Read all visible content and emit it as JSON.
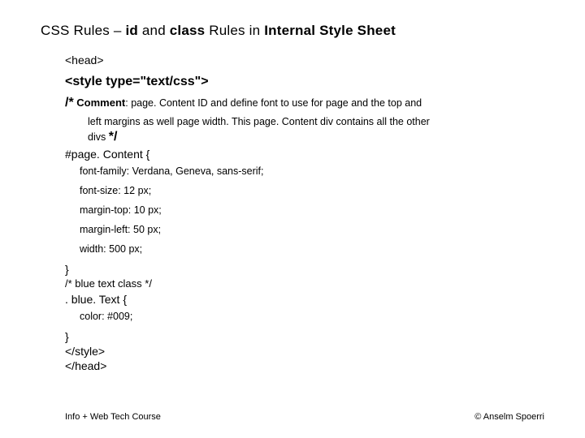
{
  "title": {
    "prefix": "CSS Rules – ",
    "bold1": "id",
    "mid1": " and ",
    "bold2": "class",
    "mid2": " Rules in ",
    "bold3": "Internal Style Sheet"
  },
  "code": {
    "head_open": "<head>",
    "style_open": "<style type=\"text/css\">",
    "comment1": {
      "open": "/*",
      "label": "Comment",
      "body1": ": page. Content ID and define font to use for page and the top and",
      "body2": "left margins as well page width. This page. Content div contains all the other",
      "body3": "divs",
      "close": "*/"
    },
    "selector1": "#page. Content {",
    "rules1": [
      "font-family: Verdana, Geneva, sans-serif;",
      "font-size: 12 px;",
      "margin-top: 10 px;",
      "margin-left: 50 px;",
      "width: 500 px;"
    ],
    "close_brace": "}",
    "comment2": "/* blue text class */",
    "selector2": ". blue. Text {",
    "rules2": [
      "color: #009;"
    ],
    "style_close": "</style>",
    "head_close": "</head>"
  },
  "footer": {
    "left": "Info + Web Tech Course",
    "right": "© Anselm Spoerri"
  }
}
